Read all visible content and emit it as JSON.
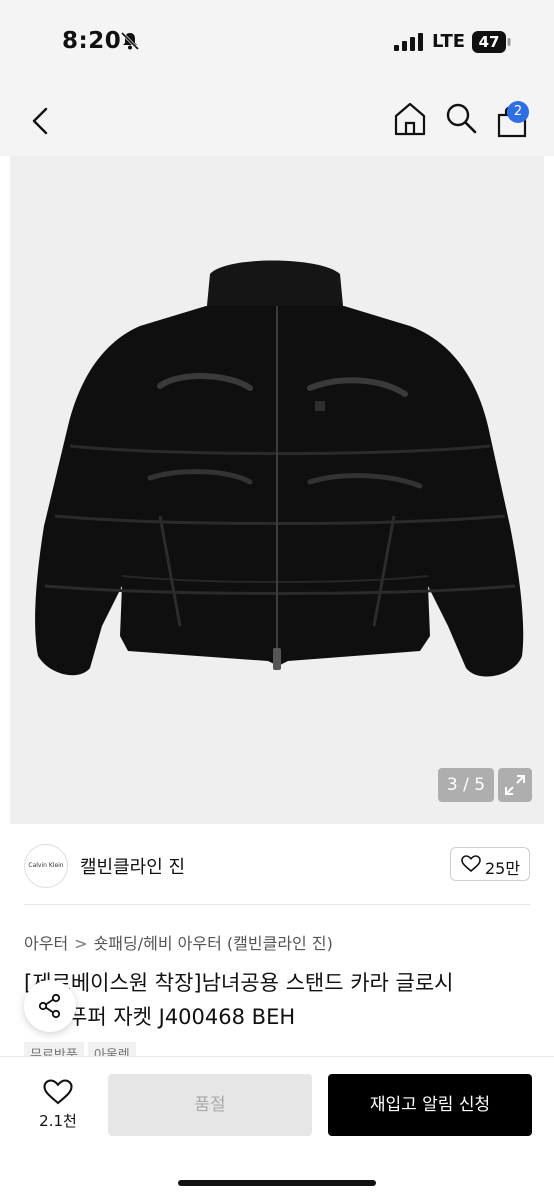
{
  "status_bar": {
    "time": "8:20",
    "network": "LTE",
    "battery": "47"
  },
  "nav": {
    "cart_count": "2"
  },
  "gallery": {
    "counter": "3 / 5"
  },
  "brand": {
    "logo_text": "Calvin Klein",
    "name": "캘빈클라인 진",
    "likes": "25만"
  },
  "breadcrumb": {
    "level1": "아우터",
    "separator": ">",
    "level2": "숏패딩/헤비 아우터",
    "brand_paren": "(캘빈클라인 진)"
  },
  "product": {
    "title_line1": "[제로베이스원 착장]남녀공용 스탠드 카라 글로시",
    "title_line2": "푸퍼 자켓 J400468 BEH",
    "tags": [
      "무료반품",
      "아울렛"
    ]
  },
  "bottom": {
    "wish_count": "2.1천",
    "soldout_label": "품절",
    "restock_label": "재입고 알림 신청"
  },
  "colors": {
    "accent_badge": "#2f6fe6",
    "primary_button": "#000000",
    "disabled_button": "#e6e6e6"
  }
}
